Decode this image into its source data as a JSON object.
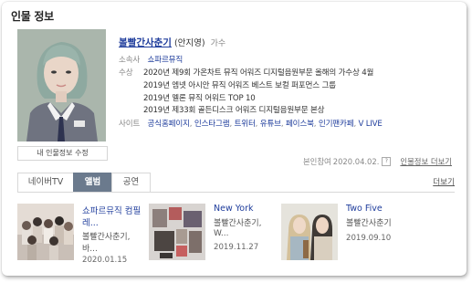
{
  "section": {
    "title": "인물 정보"
  },
  "profile": {
    "edit_button": "내 인물정보 수정",
    "name": "볼빨간사춘기",
    "real_name": "(안지영)",
    "role": "가수",
    "agency_label": "소속사",
    "agency_value": "쇼파르뮤직",
    "awards_label": "수상",
    "awards": [
      "2020년 제9회 가온차트 뮤직 어워즈 디지털음원부문 올해의 가수상 4월",
      "2019년 엠넷 아시안 뮤직 어워즈 베스트 보컬 퍼포먼스 그룹",
      "2019년 멜론 뮤직 어워드 TOP 10",
      "2019년 제33회 골든디스크 어워즈 디지털음원부문 본상"
    ],
    "sites_label": "사이트",
    "sites": [
      "공식홈페이지",
      "인스타그램",
      "트위터",
      "유튜브",
      "페이스북",
      "인기팬카페",
      "V LIVE"
    ],
    "site_separator": ","
  },
  "meta": {
    "contributor_label": "본인참여",
    "contributor_date": "2020.04.02.",
    "help_glyph": "?",
    "more_info": "인물정보 더보기"
  },
  "tabs": {
    "items": [
      {
        "label": "네이버TV",
        "active": false
      },
      {
        "label": "앨범",
        "active": true
      },
      {
        "label": "공연",
        "active": false
      }
    ],
    "more": "더보기"
  },
  "albums": [
    {
      "title_line1": "쇼파르뮤직 컴필",
      "title_line2": "레...",
      "artist_line1": "볼빨간사춘기,",
      "artist_line2": "바...",
      "date": "2020.01.15"
    },
    {
      "title_line1": "New York",
      "title_line2": "",
      "artist_line1": "볼빨간사춘기,",
      "artist_line2": "W...",
      "date": "2019.11.27"
    },
    {
      "title_line1": "Two Five",
      "title_line2": "",
      "artist_line1": "볼빨간사춘기",
      "artist_line2": "",
      "date": "2019.09.10"
    }
  ],
  "colors": {
    "link": "#1f3d9c",
    "active_tab": "#6b7a8d",
    "label_gray": "#888888"
  }
}
